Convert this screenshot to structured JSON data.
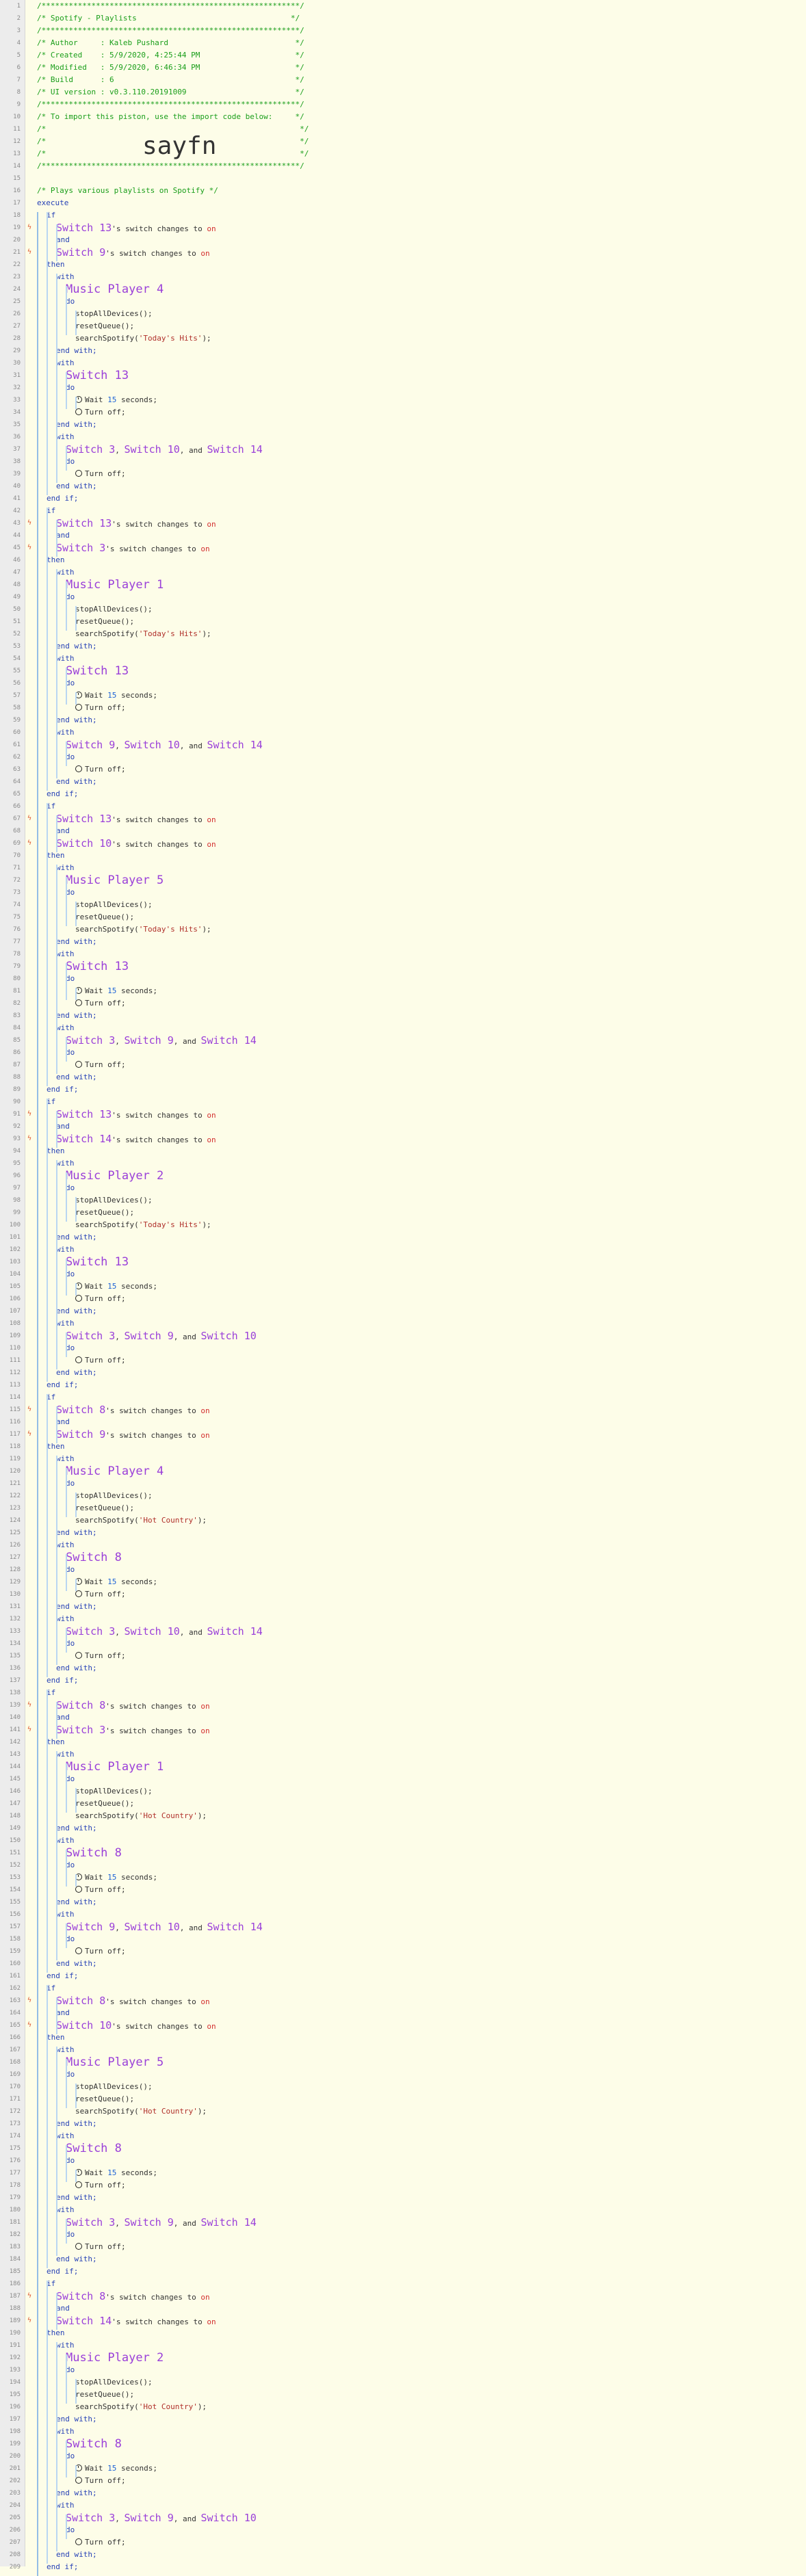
{
  "header": {
    "border": "/*********************************************************/",
    "title": "/* Spotify - Playlists                                  */",
    "author": "/* Author     : Kaleb Pushard                            */",
    "created": "/* Created    : 5/9/2020, 4:25:44 PM                     */",
    "modified": "/* Modified   : 5/9/2020, 6:46:34 PM                     */",
    "build": "/* Build      : 6                                        */",
    "ui_version": "/* UI version : v0.3.110.20191009                        */",
    "import_note": "/* To import this piston, use the import code below:     */",
    "blank": "/*                                                        */",
    "import_code": "sayfn"
  },
  "comment": "/* Plays various playlists on Spotify */",
  "keywords": {
    "execute": "execute",
    "if": "if",
    "and": "and",
    "then": "then",
    "with": "with",
    "do": "do",
    "end_with": "end with;",
    "end_if": "end if;",
    "changes": "'s switch changes to",
    "on": "on",
    "wait_prefix": "Wait",
    "wait_suffix": "seconds;",
    "wait_value": "15",
    "turn_off": "Turn off;",
    "stop_all": "stopAllDevices();",
    "reset_queue": "resetQueue();",
    "search_prefix": "searchSpotify(",
    "search_suffix": ");"
  },
  "blocks": [
    {
      "cond": [
        "Switch 13",
        "Switch 9"
      ],
      "player": "Music Player 4",
      "playlist": "'Today's Hits'",
      "timer": "Switch 13",
      "others": [
        "Switch 3",
        "Switch 10",
        "Switch 14"
      ]
    },
    {
      "cond": [
        "Switch 13",
        "Switch 3"
      ],
      "player": "Music Player 1",
      "playlist": "'Today's Hits'",
      "timer": "Switch 13",
      "others": [
        "Switch 9",
        "Switch 10",
        "Switch 14"
      ]
    },
    {
      "cond": [
        "Switch 13",
        "Switch 10"
      ],
      "player": "Music Player 5",
      "playlist": "'Today's Hits'",
      "timer": "Switch 13",
      "others": [
        "Switch 3",
        "Switch 9",
        "Switch 14"
      ]
    },
    {
      "cond": [
        "Switch 13",
        "Switch 14"
      ],
      "player": "Music Player 2",
      "playlist": "'Today's Hits'",
      "timer": "Switch 13",
      "others": [
        "Switch 3",
        "Switch 9",
        "Switch 10"
      ]
    },
    {
      "cond": [
        "Switch 8",
        "Switch 9"
      ],
      "player": "Music Player 4",
      "playlist": "'Hot Country'",
      "timer": "Switch 8",
      "others": [
        "Switch 3",
        "Switch 10",
        "Switch 14"
      ]
    },
    {
      "cond": [
        "Switch 8",
        "Switch 3"
      ],
      "player": "Music Player 1",
      "playlist": "'Hot Country'",
      "timer": "Switch 8",
      "others": [
        "Switch 9",
        "Switch 10",
        "Switch 14"
      ]
    },
    {
      "cond": [
        "Switch 8",
        "Switch 10"
      ],
      "player": "Music Player 5",
      "playlist": "'Hot Country'",
      "timer": "Switch 8",
      "others": [
        "Switch 3",
        "Switch 9",
        "Switch 14"
      ]
    },
    {
      "cond": [
        "Switch 8",
        "Switch 14"
      ],
      "player": "Music Player 2",
      "playlist": "'Hot Country'",
      "timer": "Switch 8",
      "others": [
        "Switch 3",
        "Switch 9",
        "Switch 10"
      ]
    }
  ],
  "colors": {
    "keyword": "#2742b6",
    "device": "#9a3fd9",
    "comment": "#1a9e1a",
    "value": "#d32f2f",
    "string": "#b0302a"
  }
}
